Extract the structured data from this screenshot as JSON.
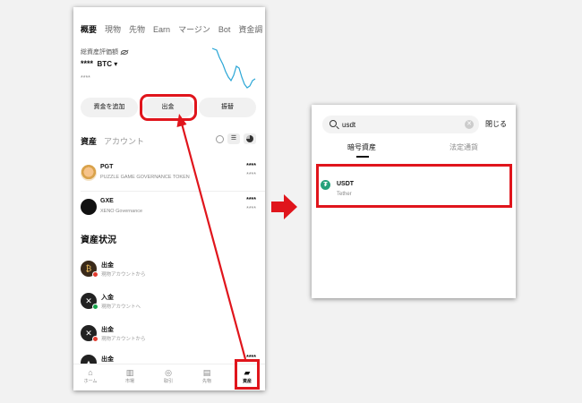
{
  "left": {
    "tabs": [
      {
        "label": "概要",
        "active": true
      },
      {
        "label": "現物",
        "active": false
      },
      {
        "label": "先物",
        "active": false
      },
      {
        "label": "Earn",
        "active": false
      },
      {
        "label": "マージン",
        "active": false
      },
      {
        "label": "Bot",
        "active": false
      },
      {
        "label": "資金調",
        "active": false
      }
    ],
    "total_label": "総資産評価額",
    "total_value": "****",
    "total_currency": "BTC ▾",
    "total_sub": "****",
    "buttons": {
      "add": "資金を追加",
      "withdraw": "出金",
      "transfer": "振替"
    },
    "asset_tab": "資産",
    "account_tab": "アカウント",
    "list_glyph": "☰",
    "assets": [
      {
        "symbol": "PGT",
        "name": "PUZZLE GAME GOVERNANCE TOKEN",
        "amount": "****",
        "sub": "****"
      },
      {
        "symbol": "GXE",
        "name": "XENO Governance",
        "amount": "****",
        "sub": "****"
      }
    ],
    "status_title": "資産状況",
    "status": [
      {
        "title": "出金",
        "sub": "現物アカウントから",
        "glyph": "₿",
        "badge_color": "#e23b2e"
      },
      {
        "title": "入金",
        "sub": "現物アカウントへ",
        "glyph": "✕",
        "badge_color": "#16a34a"
      },
      {
        "title": "出金",
        "sub": "現物アカウントから",
        "glyph": "✕",
        "badge_color": "#e23b2e"
      },
      {
        "title": "出金",
        "sub": "",
        "glyph": "▲",
        "badge_color": "#e23b2e"
      }
    ],
    "last_amount": "****",
    "nav": [
      {
        "label": "ホーム",
        "glyph": "⌂"
      },
      {
        "label": "市場",
        "glyph": "▥"
      },
      {
        "label": "取引",
        "glyph": "◎"
      },
      {
        "label": "先物",
        "glyph": "▤"
      },
      {
        "label": "資産",
        "glyph": "▰"
      }
    ]
  },
  "right": {
    "search_value": "usdt",
    "clear_glyph": "✕",
    "close_label": "閉じる",
    "tabs": [
      "暗号資産",
      "法定通貨"
    ],
    "result": {
      "symbol": "USDT",
      "name": "Tether",
      "logo_glyph": "₮"
    }
  },
  "colors": {
    "highlight": "#e0151c",
    "usdt": "#26a17b"
  }
}
